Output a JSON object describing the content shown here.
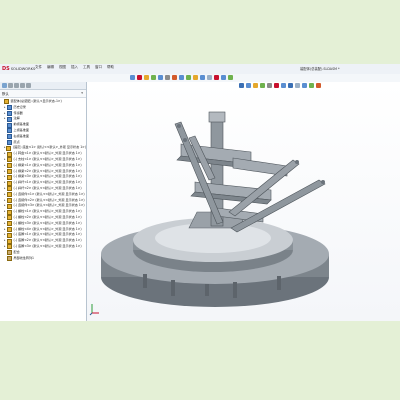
{
  "app": {
    "logo_text": "DS",
    "logo_label": "SOLIDWORKS",
    "doc_title": "装配体(总装配).SLDASM *"
  },
  "menu": [
    "文件",
    "编辑",
    "视图",
    "插入",
    "工具",
    "窗口",
    "帮助"
  ],
  "toolbar": {
    "colors": [
      "#5a8ed1",
      "#c8102e",
      "#e5a82d",
      "#6fb24e",
      "#5a8ed1",
      "#8b8b8b",
      "#d35a2b",
      "#5a8ed1",
      "#6fb24e",
      "#e5a82d",
      "#5a8ed1",
      "#9bb0c6",
      "#c8102e",
      "#5a8ed1",
      "#6fb24e"
    ]
  },
  "heads_up": {
    "colors": [
      "#3a6fb4",
      "#5a8ed1",
      "#e5a82d",
      "#6fb24e",
      "#8b8b8b",
      "#c8102e",
      "#5a8ed1",
      "#3a6fb4",
      "#9bb0c6",
      "#5a8ed1",
      "#6fb24e",
      "#d35a2b"
    ]
  },
  "left_panel": {
    "config_value": "默认",
    "tree": [
      {
        "label": "装配体(总装配) (默认<显示状态-1>)",
        "icon": "assembly"
      },
      {
        "label": "历史记录",
        "icon": "folder"
      },
      {
        "label": "传感器",
        "icon": "folder"
      },
      {
        "label": "注解",
        "icon": "folder"
      },
      {
        "label": "前视基准面",
        "icon": "plane"
      },
      {
        "label": "上视基准面",
        "icon": "plane"
      },
      {
        "label": "右视基准面",
        "icon": "plane"
      },
      {
        "label": "原点",
        "icon": "origin"
      },
      {
        "label": "(固定) 底盘<1> (默认<<默认>_外观 显示状态 1>)",
        "icon": "part"
      },
      {
        "label": "(-) 转盘<1> (默认<<默认>_外观 显示状态 1>)",
        "icon": "part"
      },
      {
        "label": "(-) 支柱<1> (默认<<默认>_外观 显示状态 1>)",
        "icon": "part"
      },
      {
        "label": "(-) 横梁<1> (默认<<默认>_外观 显示状态 1>)",
        "icon": "part"
      },
      {
        "label": "(-) 横梁<2> (默认<<默认>_外观 显示状态 1>)",
        "icon": "part"
      },
      {
        "label": "(-) 横梁<3> (默认<<默认>_外观 显示状态 1>)",
        "icon": "part"
      },
      {
        "label": "(-) 斜杆<1> (默认<<默认>_外观 显示状态 1>)",
        "icon": "part"
      },
      {
        "label": "(-) 斜杆<2> (默认<<默认>_外观 显示状态 1>)",
        "icon": "part"
      },
      {
        "label": "(-) 连接件<1> (默认<<默认>_外观 显示状态 1>)",
        "icon": "part"
      },
      {
        "label": "(-) 连接件<2> (默认<<默认>_外观 显示状态 1>)",
        "icon": "part"
      },
      {
        "label": "(-) 连接件<3> (默认<<默认>_外观 显示状态 1>)",
        "icon": "part"
      },
      {
        "label": "(-) 螺栓<1> (默认<<默认>_外观 显示状态 1>)",
        "icon": "part"
      },
      {
        "label": "(-) 螺栓<2> (默认<<默认>_外观 显示状态 1>)",
        "icon": "part"
      },
      {
        "label": "(-) 螺栓<3> (默认<<默认>_外观 显示状态 1>)",
        "icon": "part"
      },
      {
        "label": "(-) 螺栓<4> (默认<<默认>_外观 显示状态 1>)",
        "icon": "part"
      },
      {
        "label": "(-) 底脚<1> (默认<<默认>_外观 显示状态 1>)",
        "icon": "part"
      },
      {
        "label": "(-) 底脚<2> (默认<<默认>_外观 显示状态 1>)",
        "icon": "part"
      },
      {
        "label": "(-) 底脚<3> (默认<<默认>_外观 显示状态 1>)",
        "icon": "part"
      },
      {
        "label": "配合",
        "icon": "mates"
      },
      {
        "label": "局部线性阵列1",
        "icon": "feature"
      }
    ]
  },
  "model": {
    "base_color": "#9aa1a8",
    "dark_color": "#6b737b",
    "light_color": "#c9ced3",
    "highlight_color": "#dfe3e7"
  }
}
